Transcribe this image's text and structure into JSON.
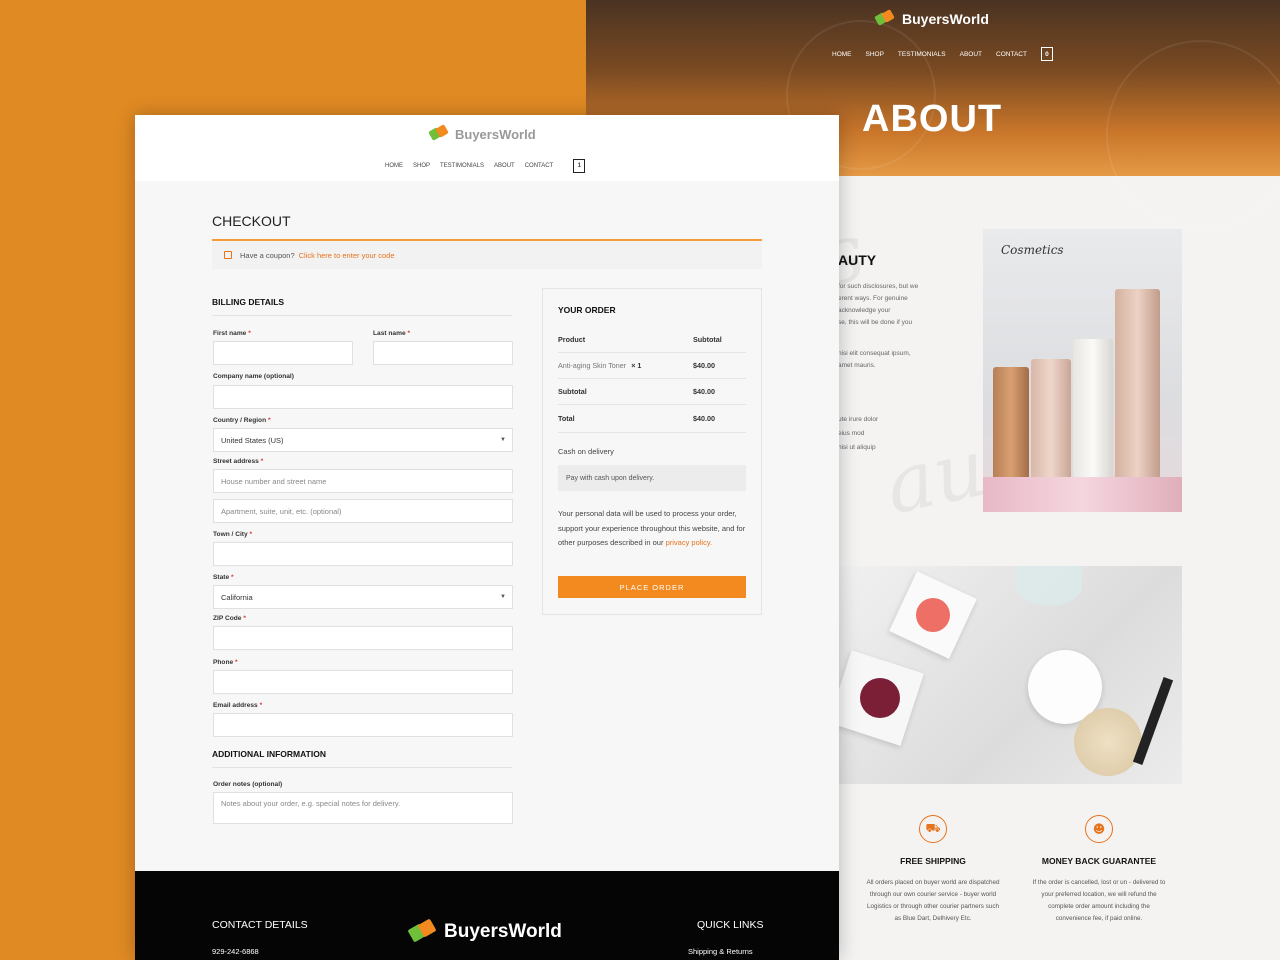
{
  "brand": {
    "name": "BuyersWorld",
    "colors": {
      "orange": "#e08a23",
      "accent": "#f28a1f",
      "green": "#6fbf3a",
      "black": "#050505"
    }
  },
  "about_page": {
    "nav": [
      "HOME",
      "SHOP",
      "TESTIMONIALS",
      "ABOUT",
      "CONTACT"
    ],
    "cart_count": "0",
    "hero_title": "ABOUT",
    "section_heading": "AUTY",
    "text_lines_1": [
      "for such disclosures, but we",
      "erent ways. For genuine",
      "acknowledge your",
      "se, this will be done if you"
    ],
    "text_lines_2": [
      "nisi elit consequat ipsum,",
      "amet mauris."
    ],
    "text_lines_3": [
      "ute irure dolor",
      "eius mod",
      "nisi ut aliquip"
    ],
    "image1_brand": "Cosmetics",
    "features": [
      {
        "icon": "truck-icon",
        "title": "FREE SHIPPING",
        "text": [
          "All orders placed on buyer world are dispatched",
          "through our own courier service - buyer world",
          "Logistics or through other courier partners such",
          "as Blue Dart, Delhivery Etc."
        ]
      },
      {
        "icon": "money-back-icon",
        "title": "MONEY BACK GUARANTEE",
        "text": [
          "If the order is cancelled, lost or un - delivered to",
          "your preferred location, we will refund the",
          "complete order amount including the",
          "convenience fee, if paid online."
        ]
      }
    ]
  },
  "checkout_page": {
    "nav": [
      "HOME",
      "SHOP",
      "TESTIMONIALS",
      "ABOUT",
      "CONTACT"
    ],
    "cart_count": "1",
    "title": "CHECKOUT",
    "coupon": {
      "text": "Have a coupon?",
      "link": "Click here to enter your code"
    },
    "billing": {
      "title": "BILLING DETAILS",
      "first_name": "First name",
      "last_name": "Last name",
      "company": "Company name (optional)",
      "country_label": "Country / Region",
      "country_value": "United States (US)",
      "street_label": "Street address",
      "street_placeholder_1": "House number and street name",
      "street_placeholder_2": "Apartment, suite, unit, etc. (optional)",
      "city_label": "Town / City",
      "state_label": "State",
      "state_value": "California",
      "zip_label": "ZIP Code",
      "phone_label": "Phone",
      "email_label": "Email address",
      "required_mark": "*"
    },
    "additional": {
      "title": "ADDITIONAL INFORMATION",
      "notes_label": "Order notes (optional)",
      "notes_placeholder": "Notes about your order, e.g. special notes for delivery."
    },
    "order": {
      "title": "YOUR ORDER",
      "col_product": "Product",
      "col_subtotal": "Subtotal",
      "item_name": "Anti-aging Skin Toner",
      "item_qty": "× 1",
      "item_price": "$40.00",
      "subtotal_label": "Subtotal",
      "subtotal_value": "$40.00",
      "total_label": "Total",
      "total_value": "$40.00",
      "payment_method": "Cash on delivery",
      "payment_note": "Pay with cash upon delivery.",
      "privacy_text": "Your personal data will be used to process your order, support your experience throughout this website, and for other purposes described in our",
      "privacy_link": "privacy policy.",
      "place_order": "PLACE ORDER"
    },
    "footer": {
      "contact_title": "CONTACT DETAILS",
      "phone": "929-242-6868",
      "quick_links_title": "QUICK LINKS",
      "shipping_link": "Shipping & Returns",
      "logo_text": "BuyersWorld"
    }
  }
}
